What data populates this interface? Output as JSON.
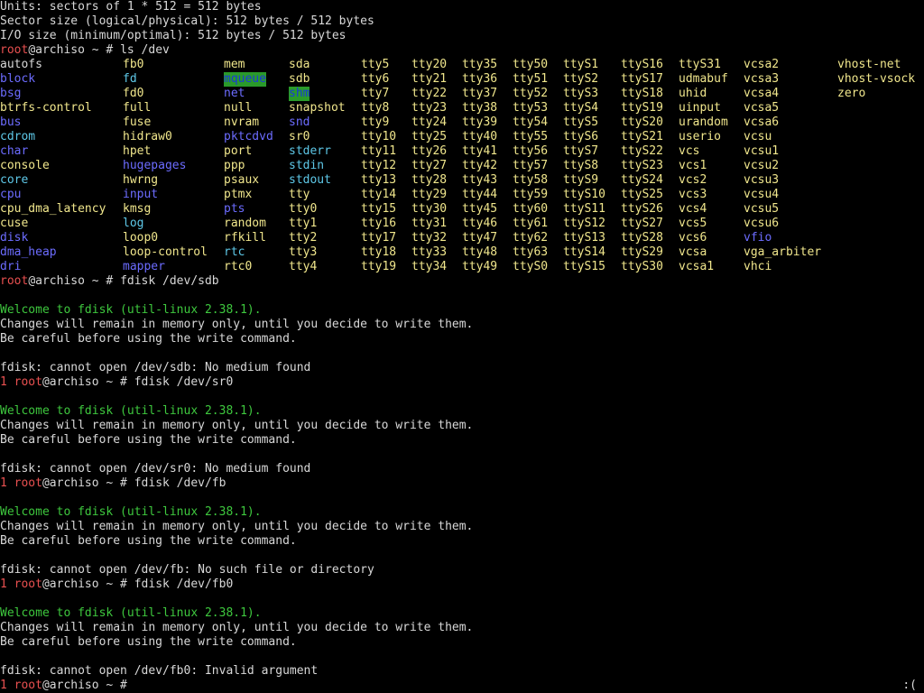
{
  "top_lines": [
    "Units: sectors of 1 * 512 = 512 bytes",
    "Sector size (logical/physical): 512 bytes / 512 bytes",
    "I/O size (minimum/optimal): 512 bytes / 512 bytes"
  ],
  "prompt": {
    "user": "root",
    "host_suffix": "@archiso ~ # ",
    "error_code": "1"
  },
  "ls_cmd": "ls /dev",
  "colors": {
    "default": "#d8d8d8",
    "dir": "#6c6cff",
    "char_device": "#f0e68c",
    "prompt_user": "#e85050",
    "welcome": "#3ec83e",
    "sticky_bg": "#2a9a2a"
  },
  "ls_columns": [
    [
      {
        "t": "autofs",
        "c": "d"
      },
      {
        "t": "block",
        "c": "b"
      },
      {
        "t": "bsg",
        "c": "b"
      },
      {
        "t": "btrfs-control",
        "c": "y"
      },
      {
        "t": "bus",
        "c": "b"
      },
      {
        "t": "cdrom",
        "c": "c"
      },
      {
        "t": "char",
        "c": "b"
      },
      {
        "t": "console",
        "c": "y"
      },
      {
        "t": "core",
        "c": "c"
      },
      {
        "t": "cpu",
        "c": "b"
      },
      {
        "t": "cpu_dma_latency",
        "c": "y"
      },
      {
        "t": "cuse",
        "c": "y"
      },
      {
        "t": "disk",
        "c": "b"
      },
      {
        "t": "dma_heap",
        "c": "b"
      },
      {
        "t": "dri",
        "c": "b"
      }
    ],
    [
      {
        "t": "fb0",
        "c": "y"
      },
      {
        "t": "fd",
        "c": "c"
      },
      {
        "t": "fd0",
        "c": "y"
      },
      {
        "t": "full",
        "c": "y"
      },
      {
        "t": "fuse",
        "c": "y"
      },
      {
        "t": "hidraw0",
        "c": "y"
      },
      {
        "t": "hpet",
        "c": "y"
      },
      {
        "t": "hugepages",
        "c": "b"
      },
      {
        "t": "hwrng",
        "c": "y"
      },
      {
        "t": "input",
        "c": "b"
      },
      {
        "t": "kmsg",
        "c": "y"
      },
      {
        "t": "log",
        "c": "c"
      },
      {
        "t": "loop0",
        "c": "y"
      },
      {
        "t": "loop-control",
        "c": "y"
      },
      {
        "t": "mapper",
        "c": "b"
      }
    ],
    [
      {
        "t": "mem",
        "c": "y"
      },
      {
        "t": "mqueue",
        "c": "h"
      },
      {
        "t": "net",
        "c": "b"
      },
      {
        "t": "null",
        "c": "y"
      },
      {
        "t": "nvram",
        "c": "y"
      },
      {
        "t": "pktcdvd",
        "c": "b"
      },
      {
        "t": "port",
        "c": "y"
      },
      {
        "t": "ppp",
        "c": "y"
      },
      {
        "t": "psaux",
        "c": "y"
      },
      {
        "t": "ptmx",
        "c": "y"
      },
      {
        "t": "pts",
        "c": "b"
      },
      {
        "t": "random",
        "c": "y"
      },
      {
        "t": "rfkill",
        "c": "y"
      },
      {
        "t": "rtc",
        "c": "c"
      },
      {
        "t": "rtc0",
        "c": "y"
      }
    ],
    [
      {
        "t": "sda",
        "c": "y"
      },
      {
        "t": "sdb",
        "c": "y"
      },
      {
        "t": "shm",
        "c": "h"
      },
      {
        "t": "snapshot",
        "c": "y"
      },
      {
        "t": "snd",
        "c": "b"
      },
      {
        "t": "sr0",
        "c": "y"
      },
      {
        "t": "stderr",
        "c": "c"
      },
      {
        "t": "stdin",
        "c": "c"
      },
      {
        "t": "stdout",
        "c": "c"
      },
      {
        "t": "tty",
        "c": "y"
      },
      {
        "t": "tty0",
        "c": "y"
      },
      {
        "t": "tty1",
        "c": "y"
      },
      {
        "t": "tty2",
        "c": "y"
      },
      {
        "t": "tty3",
        "c": "y"
      },
      {
        "t": "tty4",
        "c": "y"
      }
    ],
    [
      {
        "t": "tty5",
        "c": "y"
      },
      {
        "t": "tty6",
        "c": "y"
      },
      {
        "t": "tty7",
        "c": "y"
      },
      {
        "t": "tty8",
        "c": "y"
      },
      {
        "t": "tty9",
        "c": "y"
      },
      {
        "t": "tty10",
        "c": "y"
      },
      {
        "t": "tty11",
        "c": "y"
      },
      {
        "t": "tty12",
        "c": "y"
      },
      {
        "t": "tty13",
        "c": "y"
      },
      {
        "t": "tty14",
        "c": "y"
      },
      {
        "t": "tty15",
        "c": "y"
      },
      {
        "t": "tty16",
        "c": "y"
      },
      {
        "t": "tty17",
        "c": "y"
      },
      {
        "t": "tty18",
        "c": "y"
      },
      {
        "t": "tty19",
        "c": "y"
      }
    ],
    [
      {
        "t": "tty20",
        "c": "y"
      },
      {
        "t": "tty21",
        "c": "y"
      },
      {
        "t": "tty22",
        "c": "y"
      },
      {
        "t": "tty23",
        "c": "y"
      },
      {
        "t": "tty24",
        "c": "y"
      },
      {
        "t": "tty25",
        "c": "y"
      },
      {
        "t": "tty26",
        "c": "y"
      },
      {
        "t": "tty27",
        "c": "y"
      },
      {
        "t": "tty28",
        "c": "y"
      },
      {
        "t": "tty29",
        "c": "y"
      },
      {
        "t": "tty30",
        "c": "y"
      },
      {
        "t": "tty31",
        "c": "y"
      },
      {
        "t": "tty32",
        "c": "y"
      },
      {
        "t": "tty33",
        "c": "y"
      },
      {
        "t": "tty34",
        "c": "y"
      }
    ],
    [
      {
        "t": "tty35",
        "c": "y"
      },
      {
        "t": "tty36",
        "c": "y"
      },
      {
        "t": "tty37",
        "c": "y"
      },
      {
        "t": "tty38",
        "c": "y"
      },
      {
        "t": "tty39",
        "c": "y"
      },
      {
        "t": "tty40",
        "c": "y"
      },
      {
        "t": "tty41",
        "c": "y"
      },
      {
        "t": "tty42",
        "c": "y"
      },
      {
        "t": "tty43",
        "c": "y"
      },
      {
        "t": "tty44",
        "c": "y"
      },
      {
        "t": "tty45",
        "c": "y"
      },
      {
        "t": "tty46",
        "c": "y"
      },
      {
        "t": "tty47",
        "c": "y"
      },
      {
        "t": "tty48",
        "c": "y"
      },
      {
        "t": "tty49",
        "c": "y"
      }
    ],
    [
      {
        "t": "tty50",
        "c": "y"
      },
      {
        "t": "tty51",
        "c": "y"
      },
      {
        "t": "tty52",
        "c": "y"
      },
      {
        "t": "tty53",
        "c": "y"
      },
      {
        "t": "tty54",
        "c": "y"
      },
      {
        "t": "tty55",
        "c": "y"
      },
      {
        "t": "tty56",
        "c": "y"
      },
      {
        "t": "tty57",
        "c": "y"
      },
      {
        "t": "tty58",
        "c": "y"
      },
      {
        "t": "tty59",
        "c": "y"
      },
      {
        "t": "tty60",
        "c": "y"
      },
      {
        "t": "tty61",
        "c": "y"
      },
      {
        "t": "tty62",
        "c": "y"
      },
      {
        "t": "tty63",
        "c": "y"
      },
      {
        "t": "ttyS0",
        "c": "y"
      }
    ],
    [
      {
        "t": "ttyS1",
        "c": "y"
      },
      {
        "t": "ttyS2",
        "c": "y"
      },
      {
        "t": "ttyS3",
        "c": "y"
      },
      {
        "t": "ttyS4",
        "c": "y"
      },
      {
        "t": "ttyS5",
        "c": "y"
      },
      {
        "t": "ttyS6",
        "c": "y"
      },
      {
        "t": "ttyS7",
        "c": "y"
      },
      {
        "t": "ttyS8",
        "c": "y"
      },
      {
        "t": "ttyS9",
        "c": "y"
      },
      {
        "t": "ttyS10",
        "c": "y"
      },
      {
        "t": "ttyS11",
        "c": "y"
      },
      {
        "t": "ttyS12",
        "c": "y"
      },
      {
        "t": "ttyS13",
        "c": "y"
      },
      {
        "t": "ttyS14",
        "c": "y"
      },
      {
        "t": "ttyS15",
        "c": "y"
      }
    ],
    [
      {
        "t": "ttyS16",
        "c": "y"
      },
      {
        "t": "ttyS17",
        "c": "y"
      },
      {
        "t": "ttyS18",
        "c": "y"
      },
      {
        "t": "ttyS19",
        "c": "y"
      },
      {
        "t": "ttyS20",
        "c": "y"
      },
      {
        "t": "ttyS21",
        "c": "y"
      },
      {
        "t": "ttyS22",
        "c": "y"
      },
      {
        "t": "ttyS23",
        "c": "y"
      },
      {
        "t": "ttyS24",
        "c": "y"
      },
      {
        "t": "ttyS25",
        "c": "y"
      },
      {
        "t": "ttyS26",
        "c": "y"
      },
      {
        "t": "ttyS27",
        "c": "y"
      },
      {
        "t": "ttyS28",
        "c": "y"
      },
      {
        "t": "ttyS29",
        "c": "y"
      },
      {
        "t": "ttyS30",
        "c": "y"
      }
    ],
    [
      {
        "t": "ttyS31",
        "c": "y"
      },
      {
        "t": "udmabuf",
        "c": "y"
      },
      {
        "t": "uhid",
        "c": "y"
      },
      {
        "t": "uinput",
        "c": "y"
      },
      {
        "t": "urandom",
        "c": "y"
      },
      {
        "t": "userio",
        "c": "y"
      },
      {
        "t": "vcs",
        "c": "y"
      },
      {
        "t": "vcs1",
        "c": "y"
      },
      {
        "t": "vcs2",
        "c": "y"
      },
      {
        "t": "vcs3",
        "c": "y"
      },
      {
        "t": "vcs4",
        "c": "y"
      },
      {
        "t": "vcs5",
        "c": "y"
      },
      {
        "t": "vcs6",
        "c": "y"
      },
      {
        "t": "vcsa",
        "c": "y"
      },
      {
        "t": "vcsa1",
        "c": "y"
      }
    ],
    [
      {
        "t": "vcsa2",
        "c": "y"
      },
      {
        "t": "vcsa3",
        "c": "y"
      },
      {
        "t": "vcsa4",
        "c": "y"
      },
      {
        "t": "vcsa5",
        "c": "y"
      },
      {
        "t": "vcsa6",
        "c": "y"
      },
      {
        "t": "vcsu",
        "c": "y"
      },
      {
        "t": "vcsu1",
        "c": "y"
      },
      {
        "t": "vcsu2",
        "c": "y"
      },
      {
        "t": "vcsu3",
        "c": "y"
      },
      {
        "t": "vcsu4",
        "c": "y"
      },
      {
        "t": "vcsu5",
        "c": "y"
      },
      {
        "t": "vcsu6",
        "c": "y"
      },
      {
        "t": "vfio",
        "c": "b"
      },
      {
        "t": "vga_arbiter",
        "c": "y"
      },
      {
        "t": "vhci",
        "c": "y"
      }
    ],
    [
      {
        "t": "vhost-net",
        "c": "y"
      },
      {
        "t": "vhost-vsock",
        "c": "y"
      },
      {
        "t": "zero",
        "c": "y"
      }
    ]
  ],
  "sessions": [
    {
      "cmd": "fdisk /dev/sdb",
      "exit_shown": false,
      "welcome": "Welcome to fdisk (util-linux 2.38.1).",
      "line2": "Changes will remain in memory only, until you decide to write them.",
      "line3": "Be careful before using the write command.",
      "error": "fdisk: cannot open /dev/sdb: No medium found"
    },
    {
      "cmd": "fdisk /dev/sr0",
      "exit_shown": true,
      "welcome": "Welcome to fdisk (util-linux 2.38.1).",
      "line2": "Changes will remain in memory only, until you decide to write them.",
      "line3": "Be careful before using the write command.",
      "error": "fdisk: cannot open /dev/sr0: No medium found"
    },
    {
      "cmd": "fdisk /dev/fb",
      "exit_shown": true,
      "welcome": "Welcome to fdisk (util-linux 2.38.1).",
      "line2": "Changes will remain in memory only, until you decide to write them.",
      "line3": "Be careful before using the write command.",
      "error": "fdisk: cannot open /dev/fb: No such file or directory"
    },
    {
      "cmd": "fdisk /dev/fb0",
      "exit_shown": true,
      "welcome": "Welcome to fdisk (util-linux 2.38.1).",
      "line2": "Changes will remain in memory only, until you decide to write them.",
      "line3": "Be careful before using the write command.",
      "error": "fdisk: cannot open /dev/fb0: Invalid argument"
    }
  ],
  "final_prompt": {
    "exit_shown": true,
    "cmd": ""
  },
  "corner_text": ":("
}
